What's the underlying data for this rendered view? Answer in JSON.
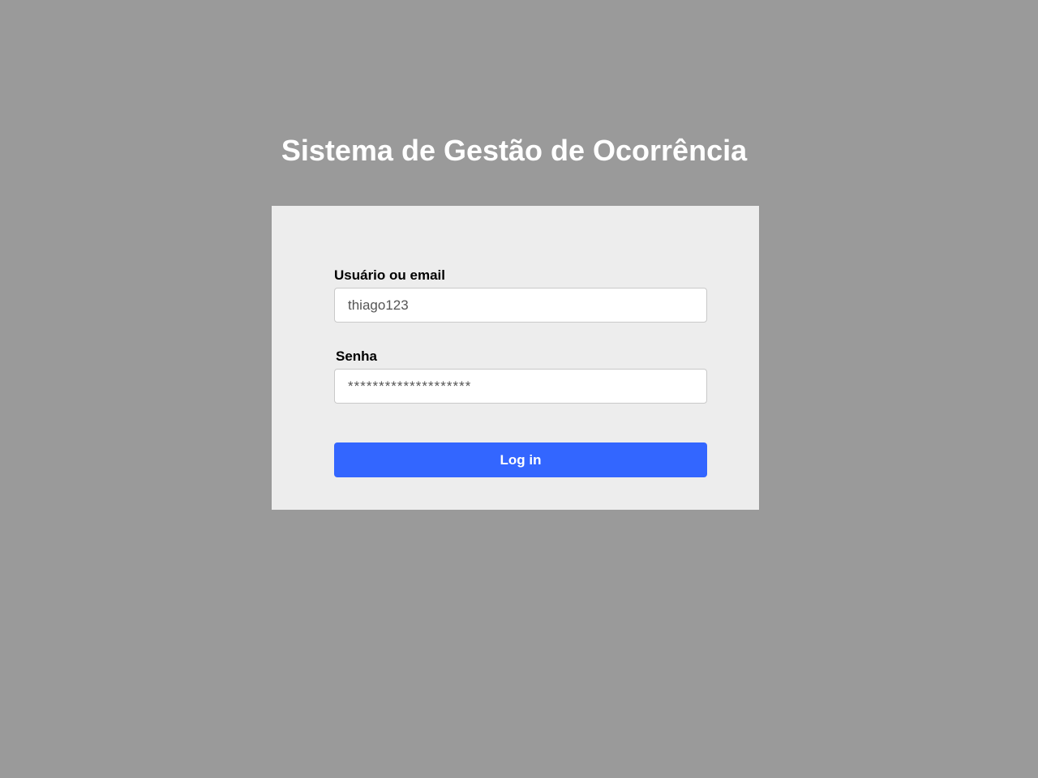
{
  "header": {
    "title": "Sistema de Gestão de Ocorrência"
  },
  "login_form": {
    "username_label": "Usuário ou email",
    "username_value": "thiago123",
    "password_label": "Senha",
    "password_value": "********************",
    "submit_label": "Log in"
  },
  "colors": {
    "background": "#9a9a9a",
    "card": "#ededed",
    "primary_button": "#3366ff",
    "title_text": "#ffffff"
  }
}
